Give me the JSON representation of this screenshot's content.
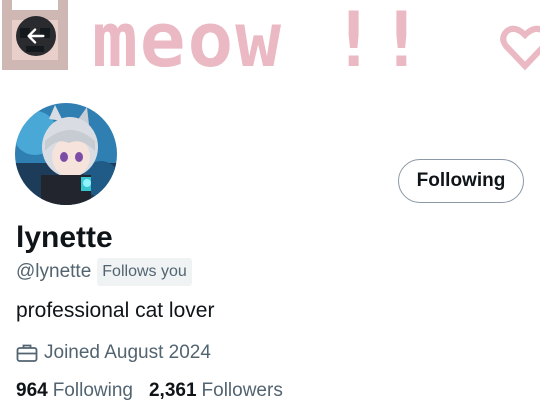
{
  "banner": {
    "text": "meow !!",
    "text_color": "#eab9c3"
  },
  "header": {
    "back_icon": "arrow-left-icon"
  },
  "profile": {
    "display_name": "lynette",
    "handle": "@lynette",
    "follows_you_badge": "Follows you",
    "bio": "professional cat lover",
    "joined": "Joined August 2024",
    "joined_icon": "briefcase-icon",
    "follow_button_label": "Following"
  },
  "stats": {
    "following_count": "964",
    "following_label": "Following",
    "followers_count": "2,361",
    "followers_label": "Followers"
  },
  "colors": {
    "text_primary": "#0f1419",
    "text_secondary": "#536471",
    "badge_bg": "#eff3f4",
    "button_border": "#8b98a5"
  }
}
